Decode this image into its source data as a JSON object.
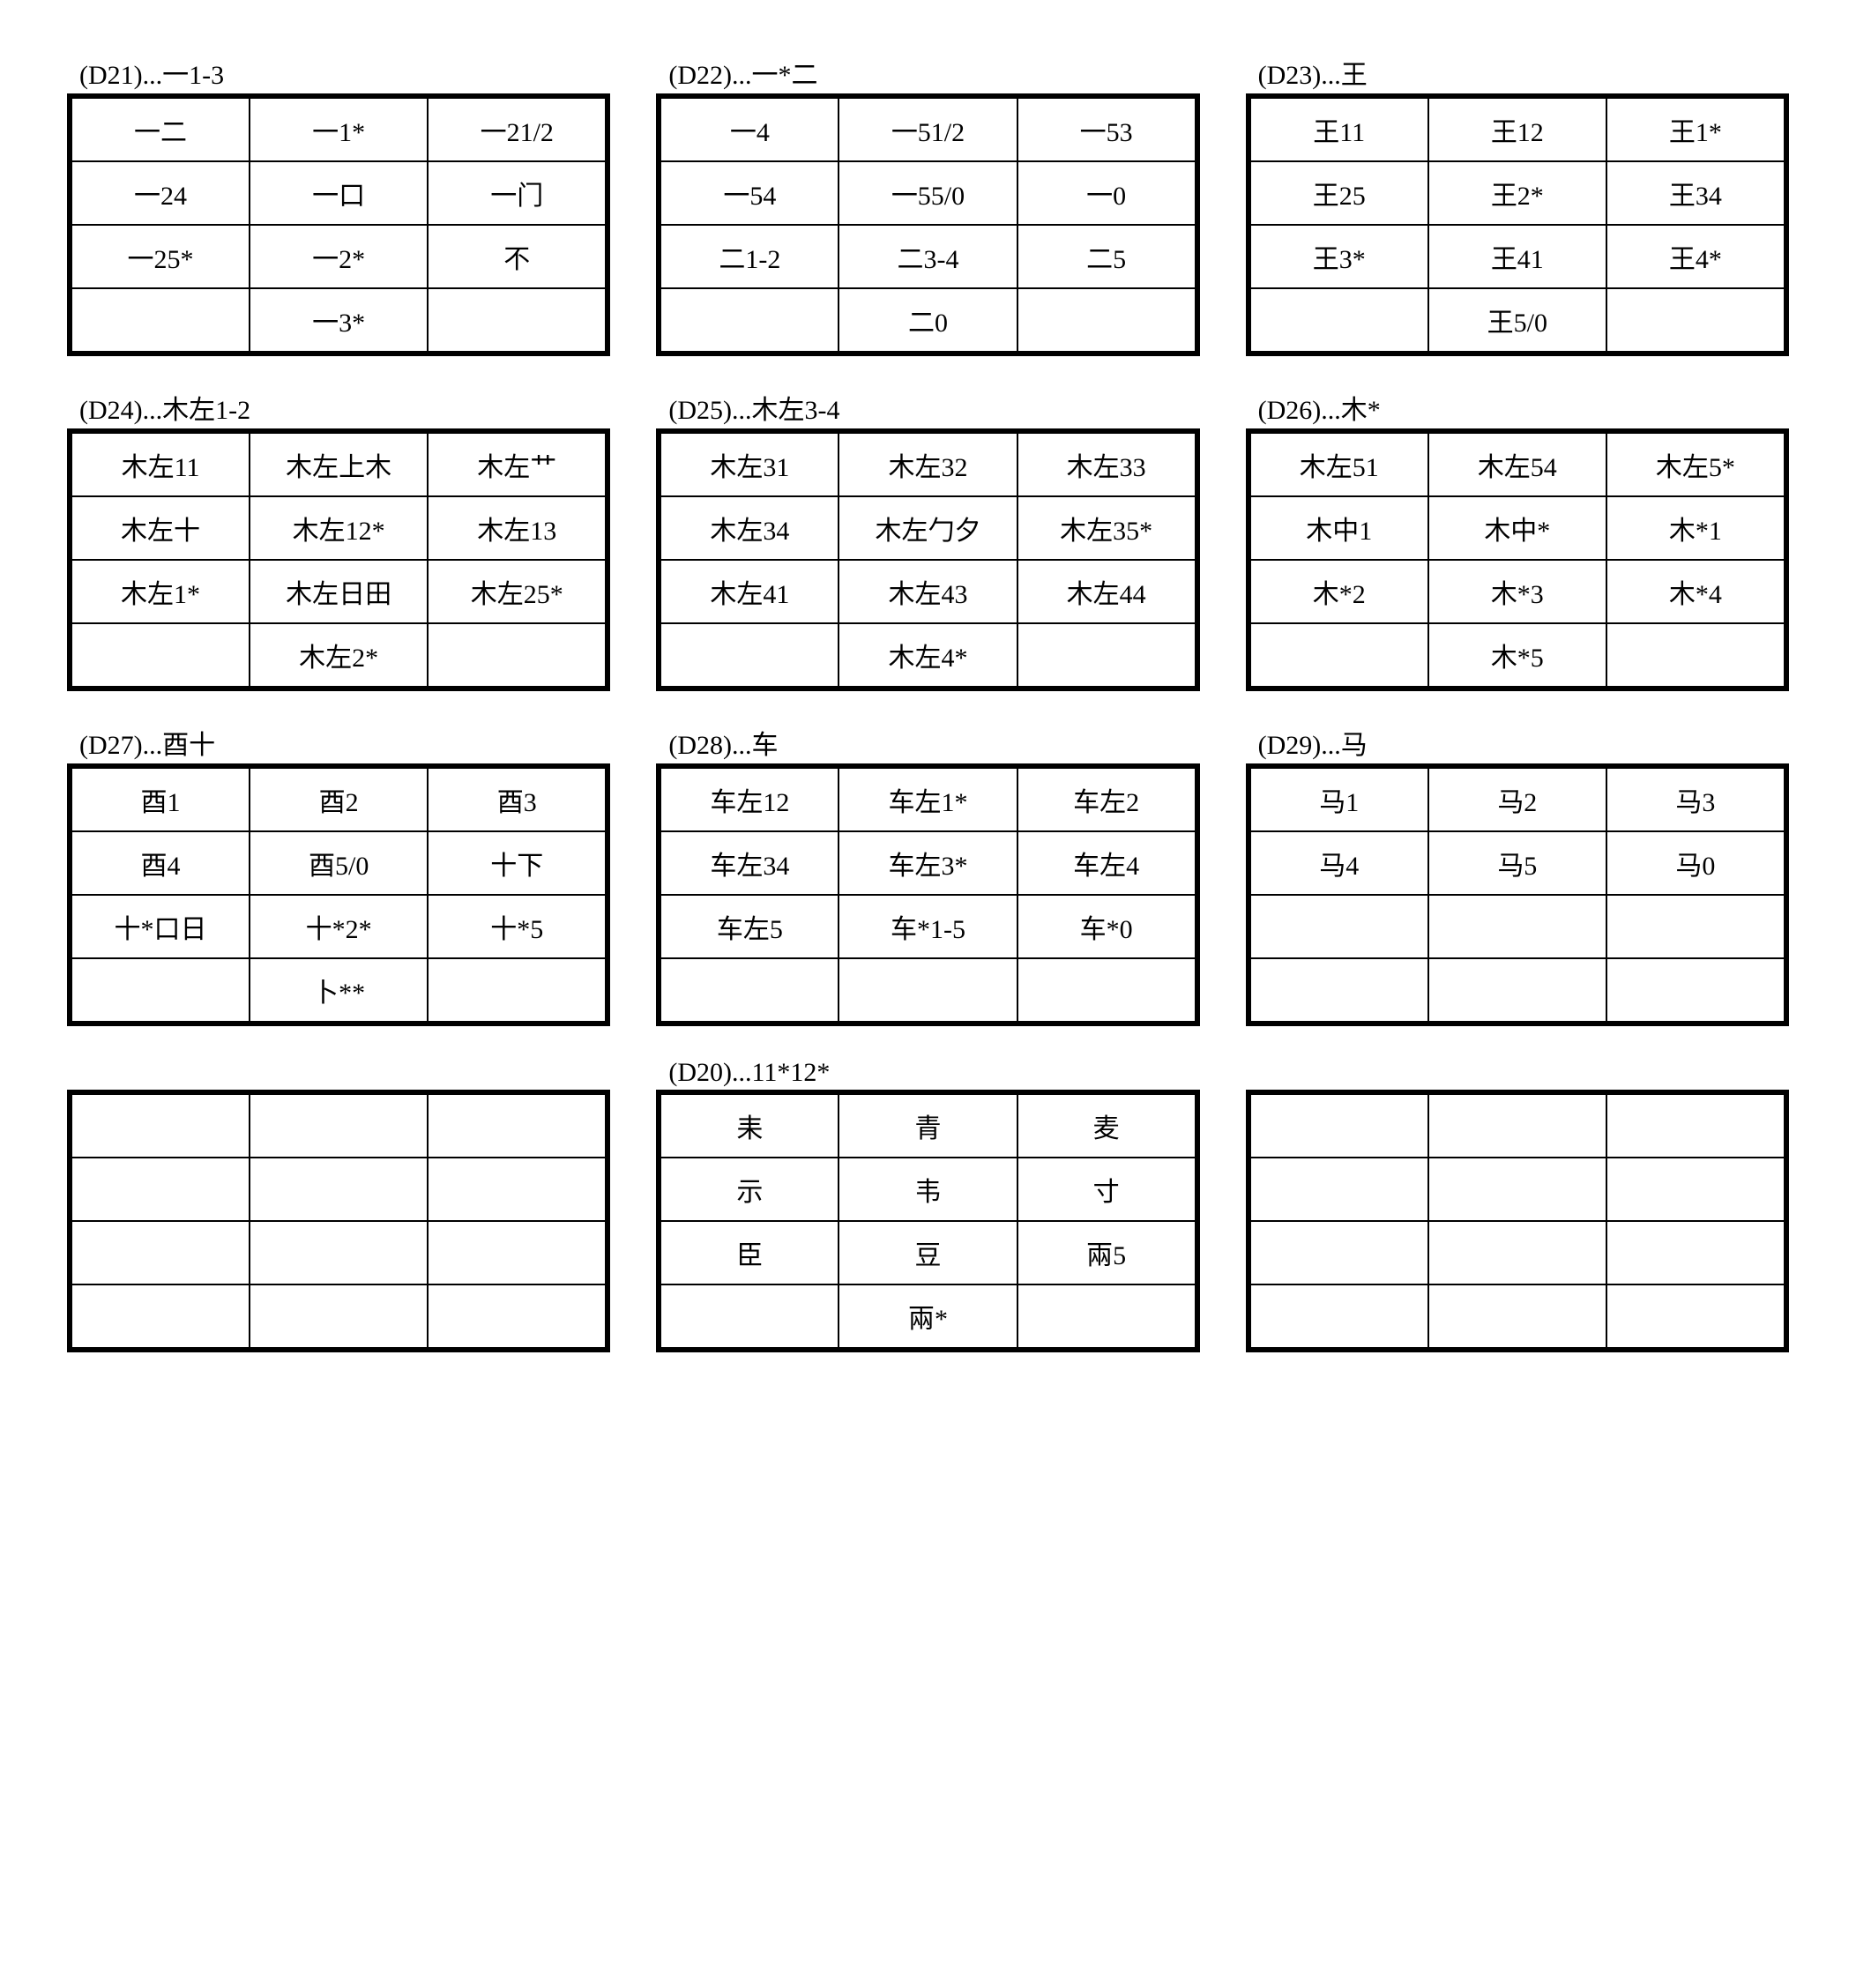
{
  "panels": [
    {
      "title": "(D21)...一1-3",
      "cells": [
        [
          "一二",
          "一1*",
          "一21/2"
        ],
        [
          "一24",
          "一口",
          "一门"
        ],
        [
          "一25*",
          "一2*",
          "不"
        ],
        [
          "",
          "一3*",
          ""
        ]
      ]
    },
    {
      "title": "(D22)...一*二",
      "cells": [
        [
          "一4",
          "一51/2",
          "一53"
        ],
        [
          "一54",
          "一55/0",
          "一0"
        ],
        [
          "二1-2",
          "二3-4",
          "二5"
        ],
        [
          "",
          "二0",
          ""
        ]
      ]
    },
    {
      "title": "(D23)...王",
      "cells": [
        [
          "王11",
          "王12",
          "王1*"
        ],
        [
          "王25",
          "王2*",
          "王34"
        ],
        [
          "王3*",
          "王41",
          "王4*"
        ],
        [
          "",
          "王5/0",
          ""
        ]
      ]
    },
    {
      "title": "(D24)...木左1-2",
      "cells": [
        [
          "木左11",
          "木左上木",
          "木左艹"
        ],
        [
          "木左十",
          "木左12*",
          "木左13"
        ],
        [
          "木左1*",
          "木左日田",
          "木左25*"
        ],
        [
          "",
          "木左2*",
          ""
        ]
      ]
    },
    {
      "title": "(D25)...木左3-4",
      "cells": [
        [
          "木左31",
          "木左32",
          "木左33"
        ],
        [
          "木左34",
          "木左勹夕",
          "木左35*"
        ],
        [
          "木左41",
          "木左43",
          "木左44"
        ],
        [
          "",
          "木左4*",
          ""
        ]
      ]
    },
    {
      "title": "(D26)...木*",
      "cells": [
        [
          "木左51",
          "木左54",
          "木左5*"
        ],
        [
          "木中1",
          "木中*",
          "木*1"
        ],
        [
          "木*2",
          "木*3",
          "木*4"
        ],
        [
          "",
          "木*5",
          ""
        ]
      ]
    },
    {
      "title": "(D27)...酉十",
      "cells": [
        [
          "酉1",
          "酉2",
          "酉3"
        ],
        [
          "酉4",
          "酉5/0",
          "十下"
        ],
        [
          "十*口日",
          "十*2*",
          "十*5"
        ],
        [
          "",
          "卜**",
          ""
        ]
      ]
    },
    {
      "title": "(D28)...车",
      "cells": [
        [
          "车左12",
          "车左1*",
          "车左2"
        ],
        [
          "车左34",
          "车左3*",
          "车左4"
        ],
        [
          "车左5",
          "车*1-5",
          "车*0"
        ],
        [
          "",
          "",
          ""
        ]
      ]
    },
    {
      "title": "(D29)...马",
      "cells": [
        [
          "马1",
          "马2",
          "马3"
        ],
        [
          "马4",
          "马5",
          "马0"
        ],
        [
          "",
          "",
          ""
        ],
        [
          "",
          "",
          ""
        ]
      ]
    },
    {
      "title": " ",
      "cells": [
        [
          "",
          "",
          ""
        ],
        [
          "",
          "",
          ""
        ],
        [
          "",
          "",
          ""
        ],
        [
          "",
          "",
          ""
        ]
      ]
    },
    {
      "title": "(D20)...11*12*",
      "cells": [
        [
          "耒",
          "青",
          "麦"
        ],
        [
          "示",
          "韦",
          "寸"
        ],
        [
          "臣",
          "豆",
          "兩5"
        ],
        [
          "",
          "兩*",
          ""
        ]
      ]
    },
    {
      "title": " ",
      "cells": [
        [
          "",
          "",
          ""
        ],
        [
          "",
          "",
          ""
        ],
        [
          "",
          "",
          ""
        ],
        [
          "",
          "",
          ""
        ]
      ]
    }
  ]
}
